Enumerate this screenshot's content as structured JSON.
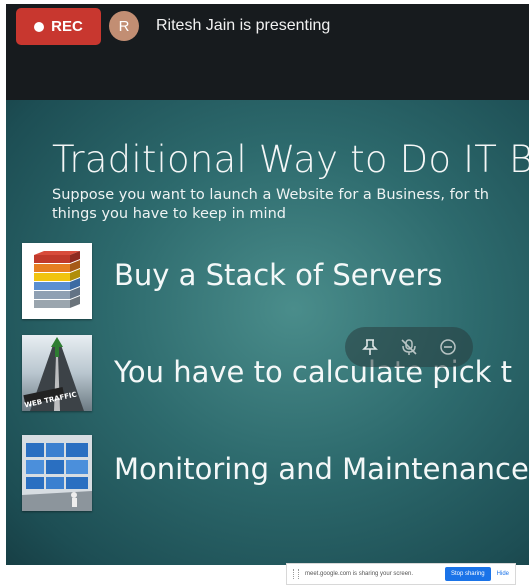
{
  "meeting": {
    "rec_label": "REC",
    "avatar_initial": "R",
    "presenter_text": "Ritesh Jain is presenting"
  },
  "slide": {
    "title": "Traditional Way to Do IT Busir",
    "subtitle_line1": "Suppose you want to launch a Website for  a Business, for th",
    "subtitle_line2": "things you have to keep in mind",
    "bullets": [
      {
        "text": "Buy a Stack of Servers",
        "icon": "server-stack-image"
      },
      {
        "text": "You have to calculate pick t",
        "icon": "web-traffic-road-image"
      },
      {
        "text": "Monitoring and Maintenance",
        "icon": "monitoring-screens-image"
      }
    ],
    "thumb_caption_traffic": "WEB TRAFFIC"
  },
  "floating_controls": {
    "icons": [
      "pin-icon",
      "mic-off-icon",
      "remove-icon"
    ]
  },
  "sharing_bar": {
    "message": "meet.google.com is sharing your screen.",
    "stop_label": "Stop sharing",
    "hide_label": "Hide"
  },
  "colors": {
    "rec": "#c8372f",
    "avatar": "#c28e73",
    "topbar": "#171b1e",
    "slide_bg": "#2d6a6d",
    "stop_button": "#1a73e8"
  }
}
